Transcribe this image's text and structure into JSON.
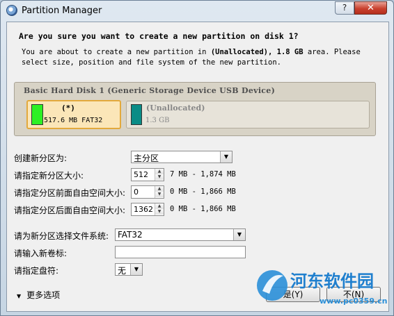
{
  "window": {
    "title": "Partition Manager",
    "help_label": "?",
    "close_label": "✕"
  },
  "dialog": {
    "heading": "Are you sure you want to create a new partition on disk 1?",
    "msg_pre": "You are about to create a new partition in ",
    "msg_part": "(Unallocated), 1.8 GB",
    "msg_post": " area. Please select size, position and file system of the new partition."
  },
  "disk": {
    "label": "Basic Hard Disk 1 (Generic Storage Device USB Device)",
    "partitions": [
      {
        "name": "(*)",
        "size": "517.6 MB FAT32",
        "color": "#2df023"
      },
      {
        "name": "(Unallocated)",
        "size": "1.3 GB",
        "color": "#0a8c86"
      }
    ]
  },
  "form": {
    "create_as_label": "创建新分区为:",
    "create_as_value": "主分区",
    "size_label": "请指定新分区大小:",
    "size_value": "512",
    "size_range": "7 MB - 1,874 MB",
    "before_label": "请指定分区前面自由空间大小:",
    "before_value": "0",
    "before_range": "0 MB - 1,866 MB",
    "after_label": "请指定分区后面自由空间大小:",
    "after_value": "1362",
    "after_range": "0 MB - 1,866 MB",
    "fs_label": "请为新分区选择文件系统:",
    "fs_value": "FAT32",
    "volume_label": "请输入新卷标:",
    "volume_value": "",
    "drive_label": "请指定盘符:",
    "drive_value": "无",
    "more_options": "更多选项"
  },
  "buttons": {
    "yes": "是(Y)",
    "no": "不(N)"
  },
  "watermark": {
    "text": "河东软件园",
    "url": "www.pc0359.cn"
  }
}
